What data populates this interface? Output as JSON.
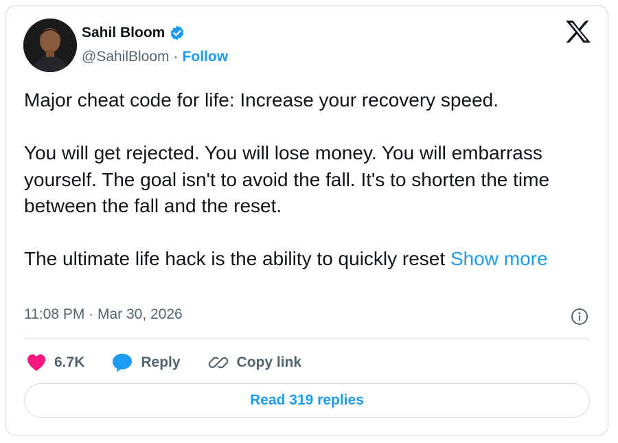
{
  "author": {
    "name": "Sahil Bloom",
    "handle": "@SahilBloom",
    "separator": "·",
    "follow_label": "Follow",
    "verified_icon": "verified-badge-icon",
    "avatar_icon": "profile-photo"
  },
  "brand": {
    "logo": "x-logo-icon"
  },
  "tweet": {
    "paragraphs": [
      "Major cheat code for life: Increase your recovery speed.",
      "You will get rejected. You will lose money. You will embarrass yourself. The goal isn't to avoid the fall. It's to shorten the time between the fall and the reset.",
      "The ultimate life hack is the ability to quickly reset "
    ],
    "show_more_label": "Show more"
  },
  "meta": {
    "timestamp": "11:08 PM · Mar 30, 2026",
    "info_icon": "info-icon"
  },
  "actions": {
    "like_count": "6.7K",
    "reply_label": "Reply",
    "copy_link_label": "Copy link"
  },
  "footer": {
    "read_replies_label": "Read 319 replies"
  },
  "colors": {
    "accent": "#1d9bf0",
    "heart": "#f91880",
    "text": "#0f1419",
    "secondary": "#536471",
    "border": "#cfd9de"
  }
}
